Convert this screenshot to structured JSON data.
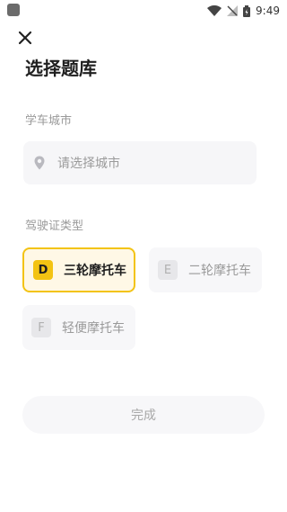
{
  "status_bar": {
    "time": "9:49"
  },
  "header": {
    "title": "选择题库"
  },
  "city_section": {
    "label": "学车城市",
    "placeholder": "请选择城市"
  },
  "license_section": {
    "label": "驾驶证类型",
    "options": [
      {
        "code": "D",
        "name": "三轮摩托车",
        "selected": true
      },
      {
        "code": "E",
        "name": "二轮摩托车",
        "selected": false
      },
      {
        "code": "F",
        "name": "轻便摩托车",
        "selected": false
      }
    ]
  },
  "footer": {
    "done_label": "完成"
  },
  "colors": {
    "accent": "#f3c313",
    "accent_bg": "#fff8e6",
    "muted": "#9a9a9a"
  }
}
